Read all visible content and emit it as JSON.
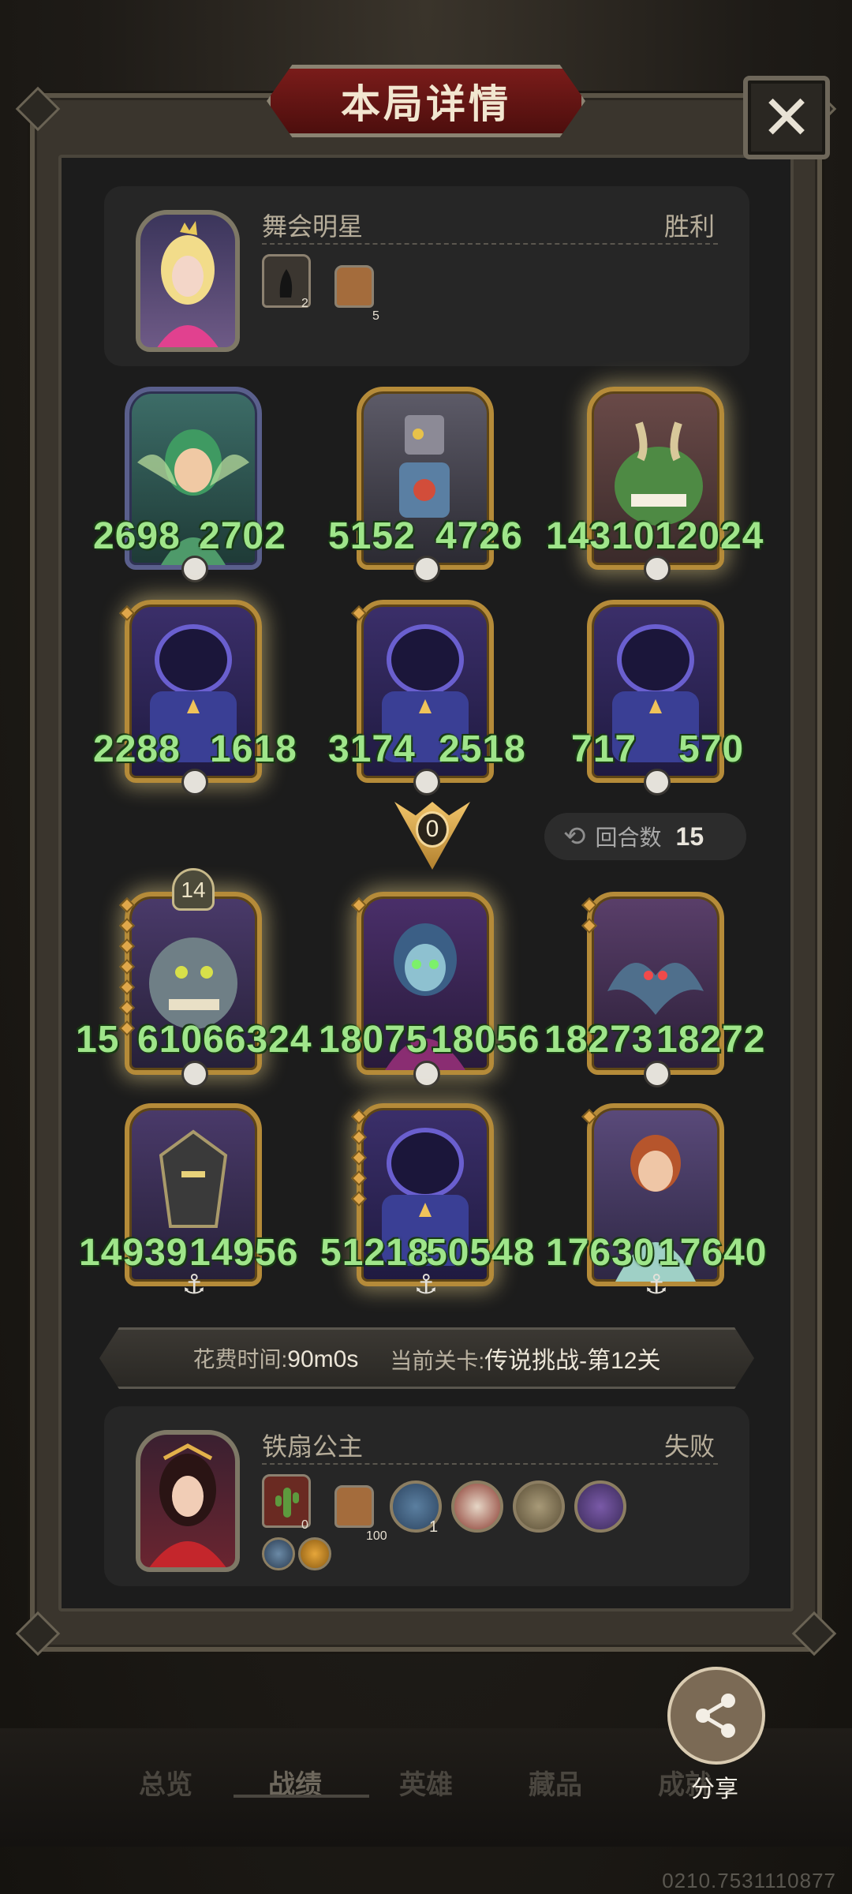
{
  "header": {
    "title": "本局详情",
    "close_icon": "close-icon"
  },
  "player1": {
    "name": "舞会明星",
    "result": "胜利",
    "badges": [
      {
        "icon": "silhouette-card-icon",
        "count": "2"
      },
      {
        "icon": "house-icon",
        "count": "5"
      }
    ]
  },
  "player1_units": [
    {
      "left": "2698",
      "right": "2702",
      "footer": "skull-icon"
    },
    {
      "left": "5152",
      "right": "4726",
      "footer": "skull-icon"
    },
    {
      "left": "14310",
      "right": "12024",
      "footer": "skull-icon"
    },
    {
      "left": "2288",
      "right": "1618",
      "footer": "skull-icon"
    },
    {
      "left": "3174",
      "right": "2518",
      "footer": "skull-icon"
    },
    {
      "left": "717",
      "right": "570",
      "footer": "skull-icon"
    }
  ],
  "battle": {
    "score": "0",
    "rounds_label": "回合数",
    "rounds_value": "15"
  },
  "player2_units": [
    {
      "left": "15",
      "right": "61066324",
      "level": "14",
      "footer": "skull-icon"
    },
    {
      "left": "18075",
      "right": "18056",
      "footer": "skull-icon"
    },
    {
      "left": "18273",
      "right": "18272",
      "footer": "skull-icon"
    },
    {
      "left": "14939",
      "right": "14956",
      "footer": "anchor-icon"
    },
    {
      "left": "51218",
      "right": "50548",
      "footer": "anchor-icon"
    },
    {
      "left": "17630",
      "right": "17640",
      "footer": "anchor-icon"
    }
  ],
  "stats": {
    "time_label": "花费时间:",
    "time_value": "90m0s",
    "stage_label": "当前关卡:",
    "stage_value": "传说挑战-第12关"
  },
  "player2": {
    "name": "铁扇公主",
    "result": "失败",
    "badges": [
      {
        "icon": "cactus-card-icon",
        "count": "0"
      },
      {
        "icon": "house-icon",
        "count": "100"
      }
    ],
    "items": [
      "fish-icon",
      "demon-mask-icon",
      "sword-icon",
      "spellbook-icon"
    ],
    "items_counts": [
      "1"
    ],
    "small_icons": [
      "swords-icon",
      "horse-icon"
    ]
  },
  "share": {
    "label": "分享"
  },
  "tabs": [
    "总览",
    "战绩",
    "英雄",
    "藏品",
    "成就"
  ],
  "footer": {
    "code": "0210.7531110877"
  }
}
